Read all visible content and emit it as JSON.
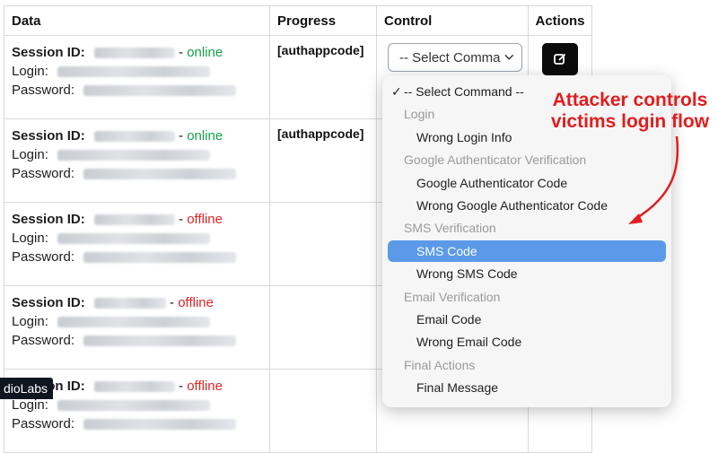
{
  "table": {
    "headers": {
      "data": "Data",
      "progress": "Progress",
      "control": "Control",
      "actions": "Actions"
    },
    "labels": {
      "session_id": "Session ID:",
      "login": "Login:",
      "password": "Password:",
      "dash": "-"
    },
    "rows": [
      {
        "status": "online",
        "progress": "[authappcode]",
        "show_control": true
      },
      {
        "status": "online",
        "progress": "[authappcode]",
        "show_control": false
      },
      {
        "status": "offline",
        "progress": "",
        "show_control": false
      },
      {
        "status": "offline",
        "progress": "",
        "show_control": false
      },
      {
        "status": "offline",
        "progress": "",
        "show_control": false
      }
    ]
  },
  "control": {
    "selected": "-- Select Command"
  },
  "menu": {
    "items": [
      {
        "type": "option",
        "label": "-- Select Command --",
        "checked": true,
        "check_glyph": "✓"
      },
      {
        "type": "header",
        "label": "Login"
      },
      {
        "type": "option",
        "label": "Wrong Login Info"
      },
      {
        "type": "header",
        "label": "Google Authenticator Verification"
      },
      {
        "type": "option",
        "label": "Google Authenticator Code"
      },
      {
        "type": "option",
        "label": "Wrong Google Authenticator Code"
      },
      {
        "type": "header",
        "label": "SMS Verification"
      },
      {
        "type": "option",
        "label": "SMS Code",
        "highlighted": true
      },
      {
        "type": "option",
        "label": "Wrong SMS Code"
      },
      {
        "type": "header",
        "label": "Email Verification"
      },
      {
        "type": "option",
        "label": "Email Code"
      },
      {
        "type": "option",
        "label": "Wrong Email Code"
      },
      {
        "type": "header",
        "label": "Final Actions"
      },
      {
        "type": "option",
        "label": "Final Message"
      }
    ]
  },
  "annotation": {
    "line1": "Attacker controls",
    "line2": "victims login flow"
  },
  "watermark": "dioLabs",
  "colors": {
    "online": "#16a34a",
    "offline": "#dc2626",
    "annotation": "#e11d1d",
    "highlight": "#5b9ae8"
  },
  "icons": {
    "edit": "edit-square-icon",
    "dropdown": "chevron-down-icon",
    "check": "checkmark-icon"
  }
}
